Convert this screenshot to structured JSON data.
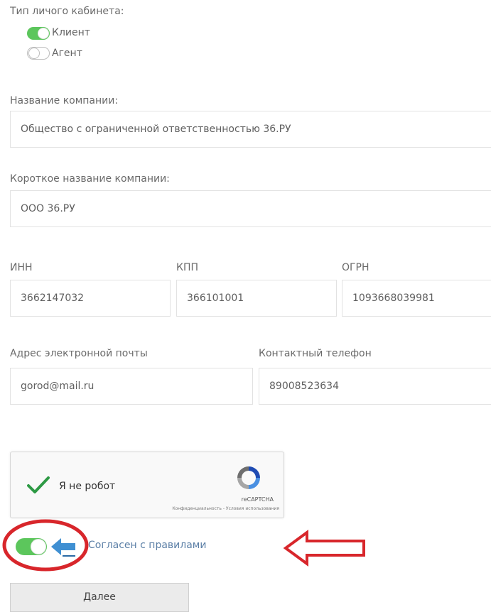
{
  "account_type": {
    "label": "Тип личого кабинета:",
    "options": [
      {
        "label": "Клиент",
        "checked": true
      },
      {
        "label": "Агент",
        "checked": false
      }
    ]
  },
  "company_name": {
    "label": "Название компании:",
    "value": "Общество с ограниченной ответственностью 36.РУ"
  },
  "short_name": {
    "label": "Короткое название компании:",
    "value": "ООО 36.РУ"
  },
  "inn": {
    "label": "ИНН",
    "value": "3662147032"
  },
  "kpp": {
    "label": "КПП",
    "value": "366101001"
  },
  "ogrn": {
    "label": "ОГРН",
    "value": "1093668039981"
  },
  "email": {
    "label": "Адрес электронной почты",
    "value": "gorod@mail.ru"
  },
  "phone": {
    "label": "Контактный телефон",
    "value": "89008523634"
  },
  "captcha": {
    "text": "Я не робот",
    "brand": "reCAPTCHA",
    "footer": "Конфиденциальность - Условия использования",
    "checked": true
  },
  "agree": {
    "label": "Согласен с правилами",
    "checked": true
  },
  "next_button": {
    "label": "Далее"
  },
  "colors": {
    "toggle_on": "#5cc65c",
    "agree_link": "#5b7fa6",
    "annotation_red": "#d8262b",
    "arrow_blue": "#3f8fd2",
    "check_green": "#2e9a45"
  }
}
